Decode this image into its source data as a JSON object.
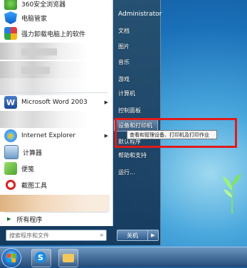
{
  "left_pane": {
    "pinned": [
      {
        "label": "360安全浏览器",
        "icon": "browser-360-icon"
      },
      {
        "label": "电脑管家",
        "icon": "pc-manager-icon"
      },
      {
        "label": "强力卸载电脑上的软件",
        "icon": "uninstall-icon"
      }
    ],
    "recent": [
      {
        "label": "Microsoft Word 2003",
        "icon": "word-icon",
        "has_submenu": true
      },
      {
        "label": "Internet Explorer",
        "icon": "ie-icon",
        "has_submenu": true
      },
      {
        "label": "计算器",
        "icon": "calculator-icon"
      },
      {
        "label": "便笺",
        "icon": "sticky-notes-icon"
      },
      {
        "label": "截图工具",
        "icon": "snipping-tool-icon"
      }
    ],
    "all_programs_label": "所有程序",
    "search_placeholder": "搜索程序和文件"
  },
  "right_pane": {
    "user": "Administrator",
    "items": [
      {
        "label": "文档"
      },
      {
        "label": "图片"
      },
      {
        "label": "音乐"
      },
      {
        "label": "游戏"
      },
      {
        "label": "计算机"
      },
      {
        "label": "控制面板"
      },
      {
        "label": "设备和打印机"
      },
      {
        "label": "默认程序"
      },
      {
        "label": "帮助和支持"
      },
      {
        "label": "运行..."
      }
    ],
    "tooltip": "查看和管理设备、打印机及打印作业",
    "shutdown_label": "关机"
  },
  "colors": {
    "highlight_box": "#e01b1b"
  }
}
